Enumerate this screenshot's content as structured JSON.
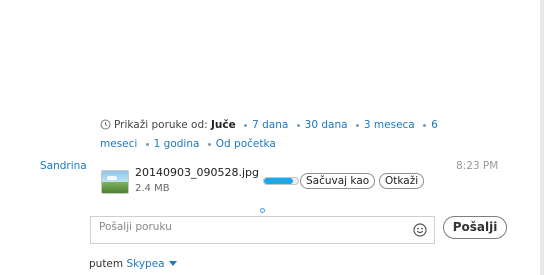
{
  "history": {
    "prefix": "Prikaži poruke od:",
    "current": "Juče",
    "options": [
      "7 dana",
      "30 dana",
      "3 meseca",
      "6 meseci",
      "1 godina",
      "Od početka"
    ]
  },
  "message": {
    "sender": "Sandrina",
    "time": "8:23 PM",
    "file": {
      "name": "20140903_090528.jpg",
      "size": "2.4 MB",
      "progress": 0.85,
      "save_label": "Sačuvaj kao",
      "cancel_label": "Otkaži"
    }
  },
  "compose": {
    "placeholder": "Pošalji poruku",
    "send_label": "Pošalji",
    "emoji_icon": "smiley-icon"
  },
  "footer": {
    "via_label": "putem",
    "service": "Skypea"
  },
  "colors": {
    "link": "#1a79c4",
    "progress": "#19a9ec"
  }
}
